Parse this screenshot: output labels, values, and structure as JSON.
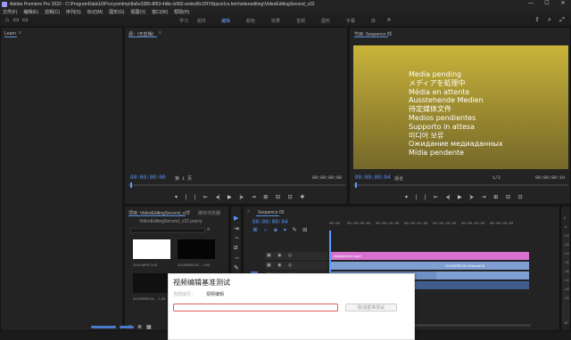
{
  "window": {
    "title": "Adobe Premiere Pro 2022 - C:\\ProgramData\\UI\\Procyon\\tmp\\8a5e3385-8f63-4dbc-b992-eedcd0c15f7d\\pyvs1rs.hmr\\videoediting\\VideoEditingSecond_v22",
    "minimize": "—",
    "maximize": "☐",
    "close": "✕"
  },
  "menu": [
    "文件(F)",
    "编辑(E)",
    "剪辑(C)",
    "序列(S)",
    "标记(M)",
    "图形(G)",
    "视图(V)",
    "窗口(W)",
    "帮助(H)"
  ],
  "workspace": {
    "tabs": [
      "学习",
      "组件",
      "编辑",
      "颜色",
      "效果",
      "音频",
      "图形",
      "字幕",
      "库"
    ],
    "active_index": 2
  },
  "learn_panel": {
    "tab": "Learn"
  },
  "source_monitor": {
    "tab": "源：(无剪辑)",
    "timecode": "00:00:00:00",
    "fit": "第 1 页",
    "end_timecode": "00:00:00:00"
  },
  "program_monitor": {
    "tab": "节目: Sequence 01",
    "media_pending_lines": [
      "Media pending",
      "メディアを処理中",
      "Média en attente",
      "Ausstehende Medien",
      "待定媒体文件",
      "Medios pendientes",
      "Supporto in attesa",
      "미디어 보류",
      "Ожидание медиаданных",
      "Mídia pendente"
    ],
    "timecode": "00:00:00:04",
    "fit": "适合",
    "quality": "1/2",
    "duration": "00:00:00:10"
  },
  "project_panel": {
    "tab": "项目: VideoEditingSecond_v22",
    "tab2": "媒体浏览器",
    "file": "VideoEditingSecond_v22.prproj",
    "items": [
      {
        "label": "2019.MP4 0:00",
        "kind": "white"
      },
      {
        "label": "20190RBC01... 0:00",
        "kind": "black"
      },
      {
        "label": "20190RBC01... 1:00",
        "kind": "dark"
      },
      {
        "label": "20190RBC01... 4:00",
        "kind": "black"
      }
    ]
  },
  "timeline": {
    "tab": "Sequence 01",
    "timecode": "00:00:00:04",
    "ruler": [
      "00:00",
      "00:00:05:00",
      "00:00:10:00",
      "00:00:15:00",
      "00:00:20:00",
      "00:00:25:00",
      "00:00:30:00"
    ],
    "clip_adjustment": "Adjustment Layer",
    "clip_video": "20190RBC01 0ebcwdl f4",
    "meter_scale": [
      "0",
      "-6",
      "-12",
      "-18",
      "-24",
      "-30",
      "-36",
      "-42",
      "-48",
      "-54",
      "dB"
    ]
  },
  "dialog": {
    "title": "视频编辑基准测试",
    "sub_label": "当前运行：",
    "sub_value": "视频编辑",
    "cancel_label": "取消基准测试"
  },
  "colors": {
    "accent": "#5e9aff",
    "bg": "#1b1b1b",
    "panel": "#232323",
    "clip_pink": "#d870d0",
    "clip_blue": "#7f9ed1"
  }
}
